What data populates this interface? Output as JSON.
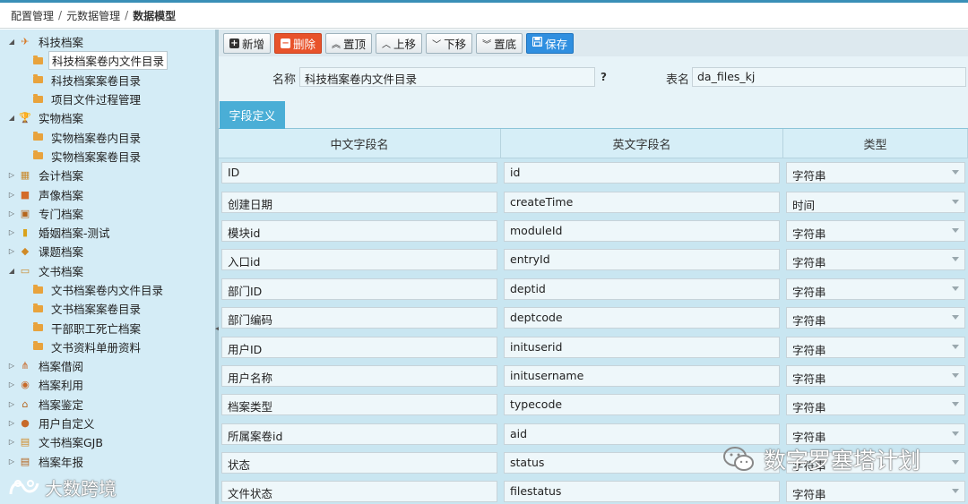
{
  "breadcrumb": [
    "配置管理",
    "元数据管理",
    "数据模型"
  ],
  "breadcrumb_sep": "/",
  "sidebar": {
    "items": [
      {
        "label": "科技档案",
        "level": 0,
        "expanded": true,
        "icon": "rocket-icon"
      },
      {
        "label": "科技档案卷内文件目录",
        "level": 1,
        "selected": true,
        "icon": "folder-icon"
      },
      {
        "label": "科技档案案卷目录",
        "level": 1,
        "icon": "folder-icon"
      },
      {
        "label": "项目文件过程管理",
        "level": 1,
        "icon": "folder-icon"
      },
      {
        "label": "实物档案",
        "level": 0,
        "expanded": true,
        "icon": "trophy-icon"
      },
      {
        "label": "实物档案卷内目录",
        "level": 1,
        "icon": "folder-icon"
      },
      {
        "label": "实物档案案卷目录",
        "level": 1,
        "icon": "folder-icon"
      },
      {
        "label": "会计档案",
        "level": 0,
        "icon": "calculator-icon"
      },
      {
        "label": "声像档案",
        "level": 0,
        "icon": "video-camera-icon"
      },
      {
        "label": "专门档案",
        "level": 0,
        "icon": "briefcase-icon"
      },
      {
        "label": "婚姻档案-测试",
        "level": 0,
        "icon": "document-stack-icon"
      },
      {
        "label": "课题档案",
        "level": 0,
        "icon": "graduation-cap-icon"
      },
      {
        "label": "文书档案",
        "level": 0,
        "expanded": true,
        "icon": "open-book-icon"
      },
      {
        "label": "文书档案卷内文件目录",
        "level": 1,
        "icon": "folder-icon"
      },
      {
        "label": "文书档案案卷目录",
        "level": 1,
        "icon": "folder-icon"
      },
      {
        "label": "干部职工死亡档案",
        "level": 1,
        "icon": "folder-icon"
      },
      {
        "label": "文书资料单册资料",
        "level": 1,
        "icon": "folder-icon"
      },
      {
        "label": "档案借阅",
        "level": 0,
        "icon": "sitemap-icon"
      },
      {
        "label": "档案利用",
        "level": 0,
        "icon": "eye-icon"
      },
      {
        "label": "档案鉴定",
        "level": 0,
        "icon": "bank-icon"
      },
      {
        "label": "用户自定义",
        "level": 0,
        "icon": "users-icon"
      },
      {
        "label": "文书档案GJB",
        "level": 0,
        "icon": "copy-icon"
      },
      {
        "label": "档案年报",
        "level": 0,
        "icon": "list-icon"
      }
    ]
  },
  "toolbar": {
    "add": "新增",
    "delete": "删除",
    "top": "置顶",
    "up": "上移",
    "down": "下移",
    "bottom": "置底",
    "save": "保存"
  },
  "form": {
    "name_label": "名称",
    "name_value": "科技档案卷内文件目录",
    "help": "?",
    "table_label": "表名",
    "table_value": "da_files_kj"
  },
  "tab": "字段定义",
  "grid": {
    "headers": [
      "中文字段名",
      "英文字段名",
      "类型"
    ],
    "rows": [
      {
        "cn": "ID",
        "en": "id",
        "type": "字符串"
      },
      {
        "cn": "创建日期",
        "en": "createTime",
        "type": "时间"
      },
      {
        "cn": "模块id",
        "en": "moduleId",
        "type": "字符串"
      },
      {
        "cn": "入口id",
        "en": "entryId",
        "type": "字符串"
      },
      {
        "cn": "部门ID",
        "en": "deptid",
        "type": "字符串"
      },
      {
        "cn": "部门编码",
        "en": "deptcode",
        "type": "字符串"
      },
      {
        "cn": "用户ID",
        "en": "inituserid",
        "type": "字符串"
      },
      {
        "cn": "用户名称",
        "en": "initusername",
        "type": "字符串"
      },
      {
        "cn": "档案类型",
        "en": "typecode",
        "type": "字符串"
      },
      {
        "cn": "所属案卷id",
        "en": "aid",
        "type": "字符串"
      },
      {
        "cn": "状态",
        "en": "status",
        "type": "字符串"
      },
      {
        "cn": "文件状态",
        "en": "filestatus",
        "type": "字符串"
      }
    ]
  },
  "watermarks": {
    "wechat": "数字罗塞塔计划",
    "brand": "大数跨境"
  }
}
